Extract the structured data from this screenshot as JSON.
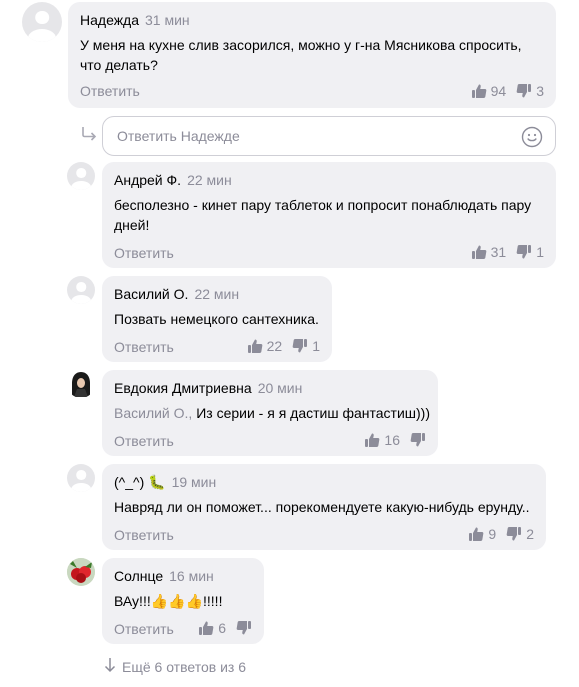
{
  "comments": [
    {
      "author": "Надежда",
      "time": "31 мин",
      "text": "У меня на кухне слив засорился, можно у г-на Мясникова спросить, что делать?",
      "reply": "Ответить",
      "likes": "94",
      "dislikes": "3"
    },
    {
      "author": "Андрей Ф.",
      "time": "22 мин",
      "text": "бесполезно - кинет пару таблеток и попросит понаблюдать пару дней!",
      "reply": "Ответить",
      "likes": "31",
      "dislikes": "1"
    },
    {
      "author": "Василий О.",
      "time": "22 мин",
      "text": "Позвать немецкого сантехника.",
      "reply": "Ответить",
      "likes": "22",
      "dislikes": "1"
    },
    {
      "author": "Евдокия Дмитриевна",
      "time": "20 мин",
      "mention": "Василий О.,",
      "text": "Из серии - я я дастиш фантастиш)))",
      "reply": "Ответить",
      "likes": "16"
    },
    {
      "author": "(^_^) 🐛",
      "time": "19 мин",
      "text": "Навряд ли он поможет... порекомендуете какую-нибудь ерунду..",
      "reply": "Ответить",
      "likes": "9",
      "dislikes": "2"
    },
    {
      "author": "Солнце",
      "time": "16 мин",
      "text": "ВАу!!!👍👍👍!!!!!",
      "reply": "Ответить",
      "likes": "6"
    }
  ],
  "reply_box": {
    "placeholder": "Ответить Надежде"
  },
  "more": {
    "label": "Ещё 6 ответов из 6"
  },
  "colors": {
    "bubble": "#f0f0f3",
    "muted": "#8c8c99",
    "border": "#cfcfd6"
  }
}
